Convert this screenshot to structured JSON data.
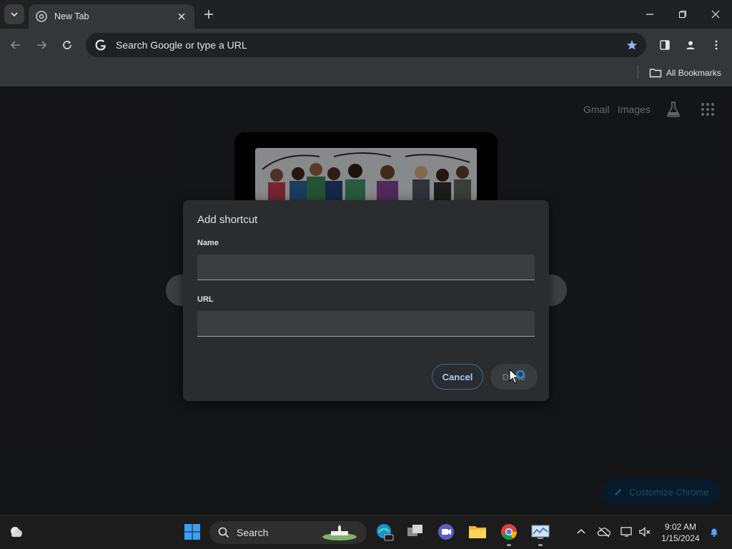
{
  "browser": {
    "tab_title": "New Tab",
    "omnibox_placeholder": "Search Google or type a URL",
    "bookmarks_label": "All Bookmarks"
  },
  "ntp": {
    "gmail": "Gmail",
    "images": "Images",
    "customize_label": "Customize Chrome"
  },
  "dialog": {
    "title": "Add shortcut",
    "name_label": "Name",
    "name_value": "",
    "url_label": "URL",
    "url_value": "",
    "cancel_label": "Cancel",
    "done_label": "Done"
  },
  "taskbar": {
    "search_label": "Search",
    "time": "9:02 AM",
    "date": "1/15/2024"
  },
  "colors": {
    "accent": "#a8c7fa",
    "page_bg": "#202124",
    "dialog_bg": "#2b2c2f"
  }
}
